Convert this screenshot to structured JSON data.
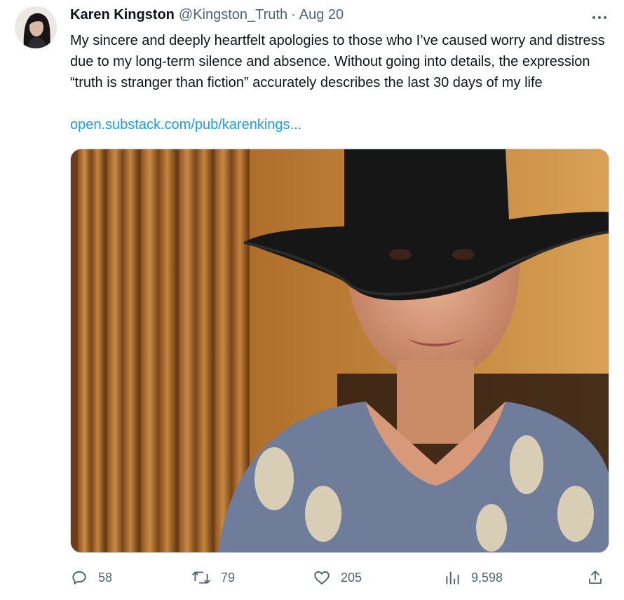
{
  "tweet": {
    "author": {
      "name": "Karen Kingston",
      "handle": "@Kingston_Truth",
      "separator": "·",
      "date": "Aug 20"
    },
    "more_label": "···",
    "text": "My sincere and deeply heartfelt apologies to those who I’ve caused worry and distress due to my long-term silence and absence. Without going into details, the expression “truth is stranger than fiction” accurately describes the last 30 days of my life",
    "link": "open.substack.com/pub/karenkings...",
    "actions": {
      "replies": "58",
      "reposts": "79",
      "likes": "205",
      "views": "9,598"
    },
    "icons": {
      "reply": "reply-icon",
      "repost": "repost-icon",
      "like": "heart-icon",
      "views": "views-icon",
      "share": "share-icon",
      "more": "more-icon"
    },
    "colors": {
      "link": "#1d9bf0",
      "secondary_text": "#536471",
      "primary_text": "#0f1419"
    }
  }
}
